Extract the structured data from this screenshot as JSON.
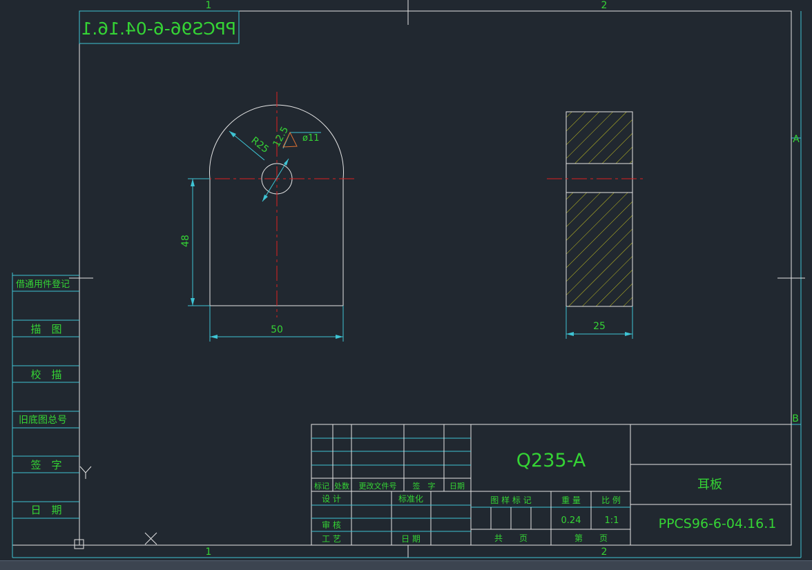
{
  "border": {
    "zone_top_1": "1",
    "zone_top_2": "2",
    "zone_bottom_1": "1",
    "zone_bottom_2": "2",
    "zone_right_a": "A",
    "zone_right_b": "B"
  },
  "mirrored_code": "PPCS96-6-04.16.1",
  "side_panel": [
    "借通用件登记",
    "描　图",
    "校　描",
    "旧底图总号",
    "签　字",
    "日　期"
  ],
  "dimensions": {
    "radius": "R25",
    "hole_diameter": "ø11",
    "offset": "12.5",
    "height": "48",
    "width": "50",
    "thickness": "25"
  },
  "title_block": {
    "material": "Q235-A",
    "part_name": "耳板",
    "drawing_number": "PPCS96-6-04.16.1",
    "rev_headers": [
      "标记",
      "处数",
      "更改文件号",
      "签　字",
      "日期"
    ],
    "design": "设 计",
    "standardize": "标准化",
    "review": "审 核",
    "process": "工 艺",
    "date": "日 期",
    "stage_mark": "图 样 标 记",
    "weight_label": "重 量",
    "scale_label": "比 例",
    "weight": "0.24",
    "scale": "1:1",
    "total_sheets": "共　　页",
    "sheet_no": "第　　页"
  },
  "axis_y_label": "Y"
}
